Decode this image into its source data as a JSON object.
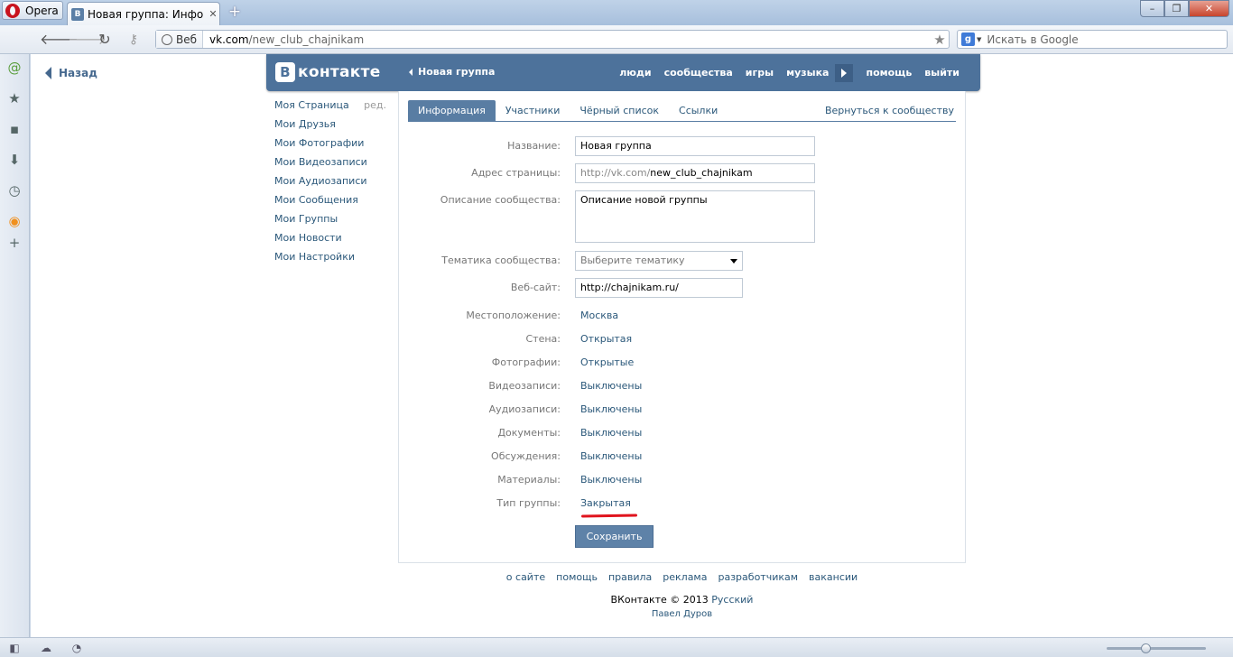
{
  "browser": {
    "menu_label": "Opera",
    "tab_title": "Новая группа: Инфор...",
    "tab_close": "✕",
    "new_tab": "+",
    "address_web_label": "Веб",
    "address_host": "vk.com",
    "address_path": "/new_club_chajnikam",
    "search_placeholder": "Искать в Google",
    "window_buttons": [
      "–",
      "❐",
      "✕"
    ]
  },
  "page": {
    "back_label": "Назад"
  },
  "vk_header": {
    "logo_badge": "В",
    "logo_text": "контакте",
    "crumb": "Новая группа",
    "nav": [
      "люди",
      "сообщества",
      "игры",
      "музыка",
      "помощь",
      "выйти"
    ]
  },
  "left_menu": {
    "edit_label": "ред.",
    "items": [
      "Моя Страница",
      "Мои Друзья",
      "Мои Фотографии",
      "Мои Видеозаписи",
      "Мои Аудиозаписи",
      "Мои Сообщения",
      "Мои Группы",
      "Мои Новости",
      "Мои Настройки"
    ]
  },
  "tabs": {
    "items": [
      "Информация",
      "Участники",
      "Чёрный список",
      "Ссылки"
    ],
    "active_index": 0,
    "return_label": "Вернуться к сообществу"
  },
  "form": {
    "name": {
      "label": "Название:",
      "value": "Новая группа"
    },
    "address": {
      "label": "Адрес страницы:",
      "prefix": "http://vk.com/",
      "value": "new_club_chajnikam"
    },
    "description": {
      "label": "Описание сообщества:",
      "value": "Описание новой группы"
    },
    "topic": {
      "label": "Тематика сообщества:",
      "value": "Выберите тематику"
    },
    "website": {
      "label": "Веб-сайт:",
      "value": "http://chajnikam.ru/"
    },
    "settings": [
      {
        "label": "Местоположение:",
        "value": "Москва"
      },
      {
        "label": "Стена:",
        "value": "Открытая"
      },
      {
        "label": "Фотографии:",
        "value": "Открытые"
      },
      {
        "label": "Видеозаписи:",
        "value": "Выключены"
      },
      {
        "label": "Аудиозаписи:",
        "value": "Выключены"
      },
      {
        "label": "Документы:",
        "value": "Выключены"
      },
      {
        "label": "Обсуждения:",
        "value": "Выключены"
      },
      {
        "label": "Материалы:",
        "value": "Выключены"
      },
      {
        "label": "Тип группы:",
        "value": "Закрытая"
      }
    ],
    "save_label": "Сохранить"
  },
  "footer": {
    "links": [
      "о сайте",
      "помощь",
      "правила",
      "реклама",
      "разработчикам",
      "вакансии"
    ],
    "copyright": "ВКонтакте © 2013",
    "language": "Русский",
    "author": "Павел Дуров"
  },
  "colors": {
    "vk_header": "#4d729b",
    "link": "#2b587a",
    "active_tab": "#597da3",
    "highlight_underline": "#e0141e"
  }
}
